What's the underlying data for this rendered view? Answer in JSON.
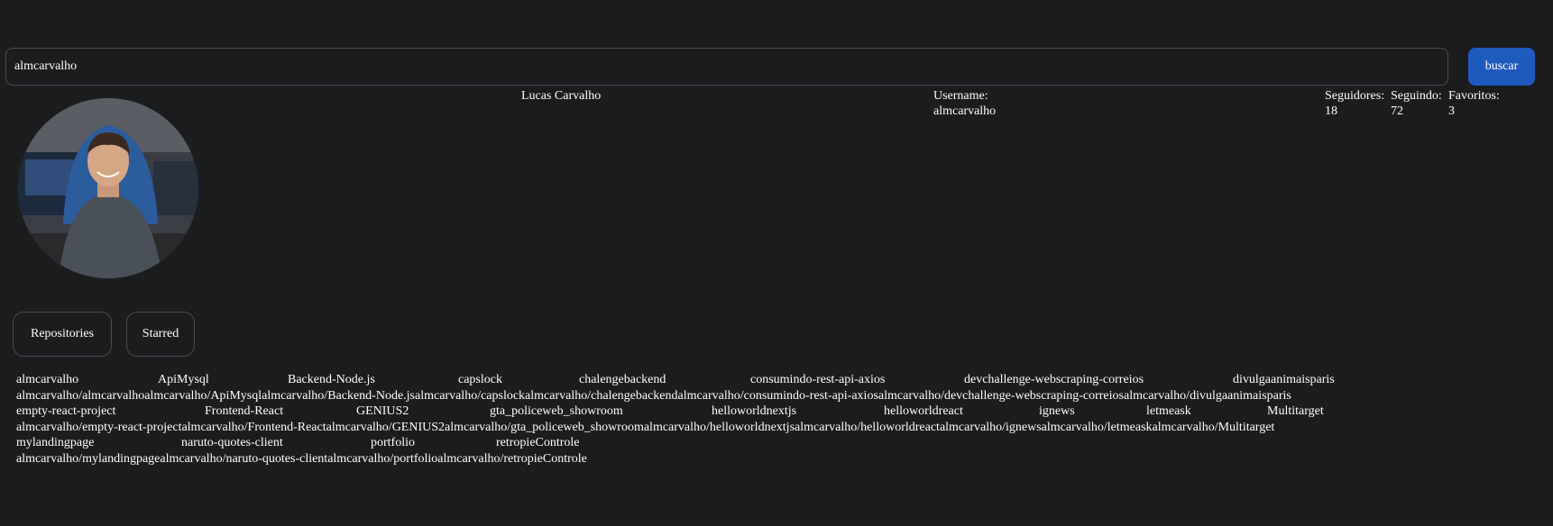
{
  "search": {
    "value": "almcarvalho",
    "button_label": "buscar"
  },
  "profile": {
    "name": "Lucas Carvalho",
    "username_label": "Username:",
    "username": "almcarvalho",
    "followers_label": "Seguidores:",
    "followers": "18",
    "following_label": "Seguindo:",
    "following": "72",
    "favorites_label": "Favoritos:",
    "favorites": "3"
  },
  "tabs": {
    "repositories": "Repositories",
    "starred": "Starred"
  },
  "repos": {
    "names_1": [
      "almcarvalho",
      "ApiMysql",
      "Backend-Node.js",
      "capslock",
      "chalengebackend",
      "consumindo-rest-api-axios",
      "devchallenge-webscraping-correios",
      "divulgaanimaisparis"
    ],
    "paths_1": "almcarvalho/almcarvalhoalmcarvalho/ApiMysqlalmcarvalho/Backend-Node.jsalmcarvalho/capslockalmcarvalho/chalengebackendalmcarvalho/consumindo-rest-api-axiosalmcarvalho/devchallenge-webscraping-correiosalmcarvalho/divulgaanimaisparis",
    "names_2": [
      "empty-react-project",
      "Frontend-React",
      "GENIUS2",
      "gta_policeweb_showroom",
      "helloworldnextjs",
      "helloworldreact",
      "ignews",
      "letmeask",
      "Multitarget"
    ],
    "paths_2": "almcarvalho/empty-react-projectalmcarvalho/Frontend-Reactalmcarvalho/GENIUS2almcarvalho/gta_policeweb_showroomalmcarvalho/helloworldnextjsalmcarvalho/helloworldreactalmcarvalho/ignewsalmcarvalho/letmeaskalmcarvalho/Multitarget",
    "names_3": [
      "mylandingpage",
      "naruto-quotes-client",
      "portfolio",
      "retropieControle"
    ],
    "paths_3": "almcarvalho/mylandingpagealmcarvalho/naruto-quotes-clientalmcarvalho/portfolioalmcarvalho/retropieControle"
  },
  "colors": {
    "background": "#1b1c1e",
    "accent": "#1f5abf",
    "border": "#4a4b4f"
  }
}
